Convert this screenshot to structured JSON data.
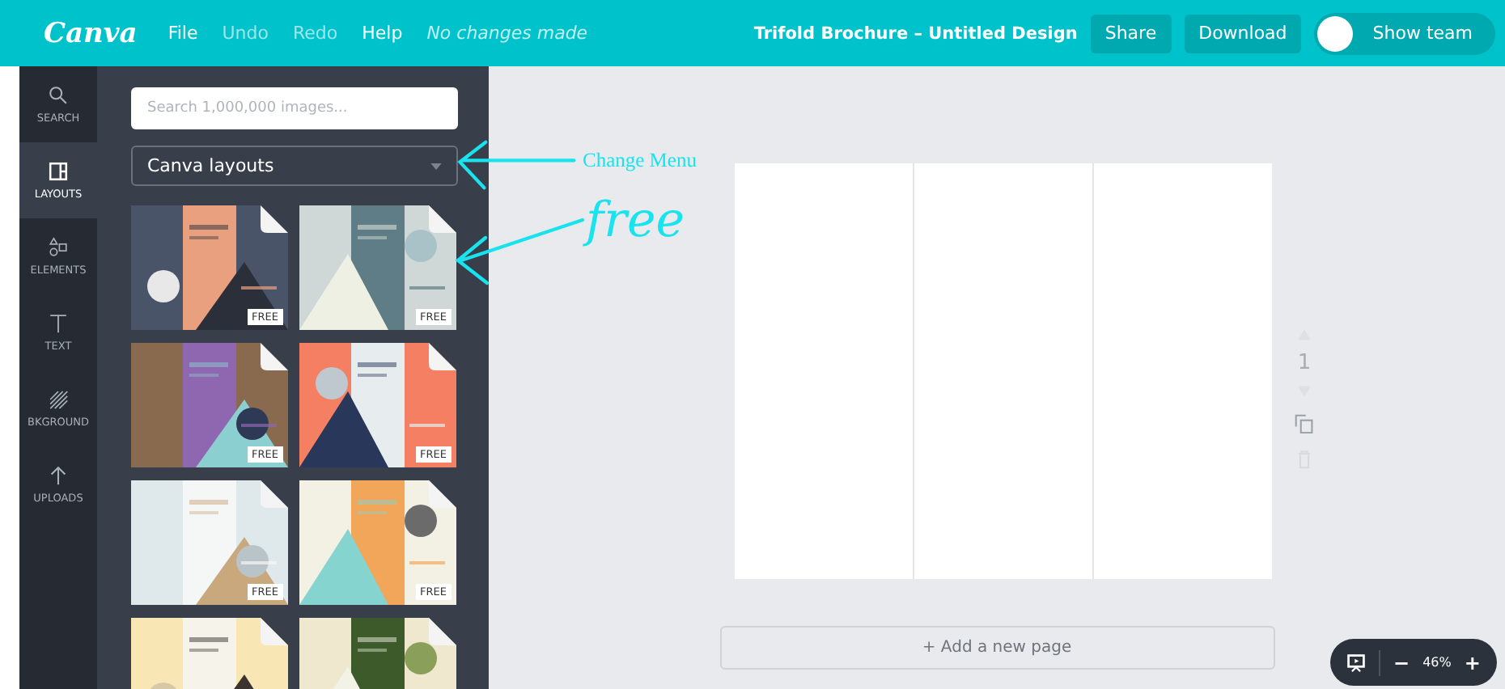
{
  "topbar": {
    "logo": "Canva",
    "menu": [
      {
        "label": "File",
        "disabled": false
      },
      {
        "label": "Undo",
        "disabled": true
      },
      {
        "label": "Redo",
        "disabled": true
      },
      {
        "label": "Help",
        "disabled": false
      }
    ],
    "status": "No changes made",
    "title": "Trifold Brochure – Untitled Design",
    "buttons": [
      "Share",
      "Download"
    ],
    "team_toggle": {
      "label": "Show team",
      "on": false
    }
  },
  "sidebar": {
    "items": [
      {
        "label": "SEARCH",
        "selected": false
      },
      {
        "label": "LAYOUTS",
        "selected": true
      },
      {
        "label": "ELEMENTS",
        "selected": false
      },
      {
        "label": "TEXT",
        "selected": false
      },
      {
        "label": "BKGROUND",
        "selected": false
      },
      {
        "label": "UPLOADS",
        "selected": false
      }
    ]
  },
  "panel": {
    "search": {
      "placeholder": "Search 1,000,000 images..."
    },
    "dropdown": {
      "value": "Canva layouts"
    },
    "templates": [
      {
        "kind": "picture",
        "badge": "FREE"
      },
      {
        "kind": "picture",
        "badge": "FREE"
      },
      {
        "kind": "picture",
        "badge": "FREE"
      },
      {
        "kind": "picture",
        "badge": "FREE"
      },
      {
        "kind": "picture",
        "badge": "FREE"
      },
      {
        "kind": "picture",
        "badge": "FREE"
      },
      {
        "kind": "picture"
      },
      {
        "kind": "picture"
      }
    ]
  },
  "annotations": [
    {
      "kind": "label",
      "text": "Change Menu"
    },
    {
      "kind": "scrawl",
      "text": "free"
    }
  ],
  "page_controls": {
    "page_number": "1"
  },
  "add_page": "+ Add a new page",
  "zoom": {
    "minus": "−",
    "value": "46%",
    "plus": "+"
  }
}
